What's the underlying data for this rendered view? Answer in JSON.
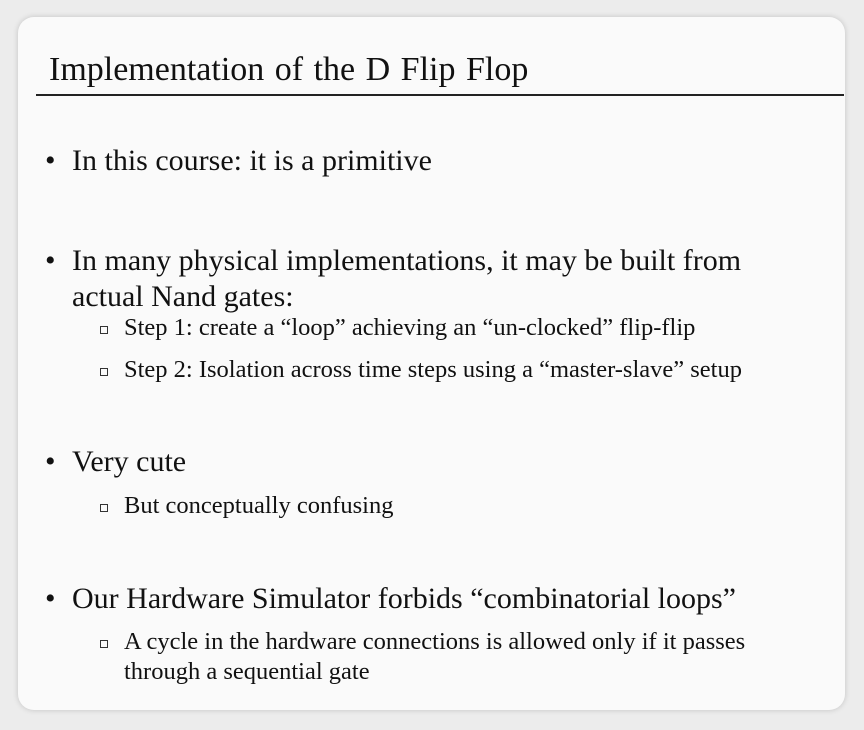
{
  "slide": {
    "title": "Implementation of the D Flip Flop",
    "bullet_char": "•",
    "bullets": [
      {
        "lines": [
          "In this course: it is a primitive"
        ],
        "subs": []
      },
      {
        "lines": [
          "In many physical implementations, it may be built from",
          "actual Nand gates:"
        ],
        "subs": [
          {
            "lines": [
              "Step 1: create a “loop” achieving an “un-clocked” flip-flip"
            ]
          },
          {
            "lines": [
              "Step 2: Isolation across time steps using a “master-slave” setup"
            ]
          }
        ]
      },
      {
        "lines": [
          "Very cute"
        ],
        "subs": [
          {
            "lines": [
              "But conceptually confusing"
            ]
          }
        ]
      },
      {
        "lines": [
          "Our Hardware Simulator forbids “combinatorial loops”"
        ],
        "subs": [
          {
            "lines": [
              "A cycle in the hardware connections is allowed only if it passes",
              "through a sequential gate"
            ]
          }
        ]
      }
    ]
  }
}
